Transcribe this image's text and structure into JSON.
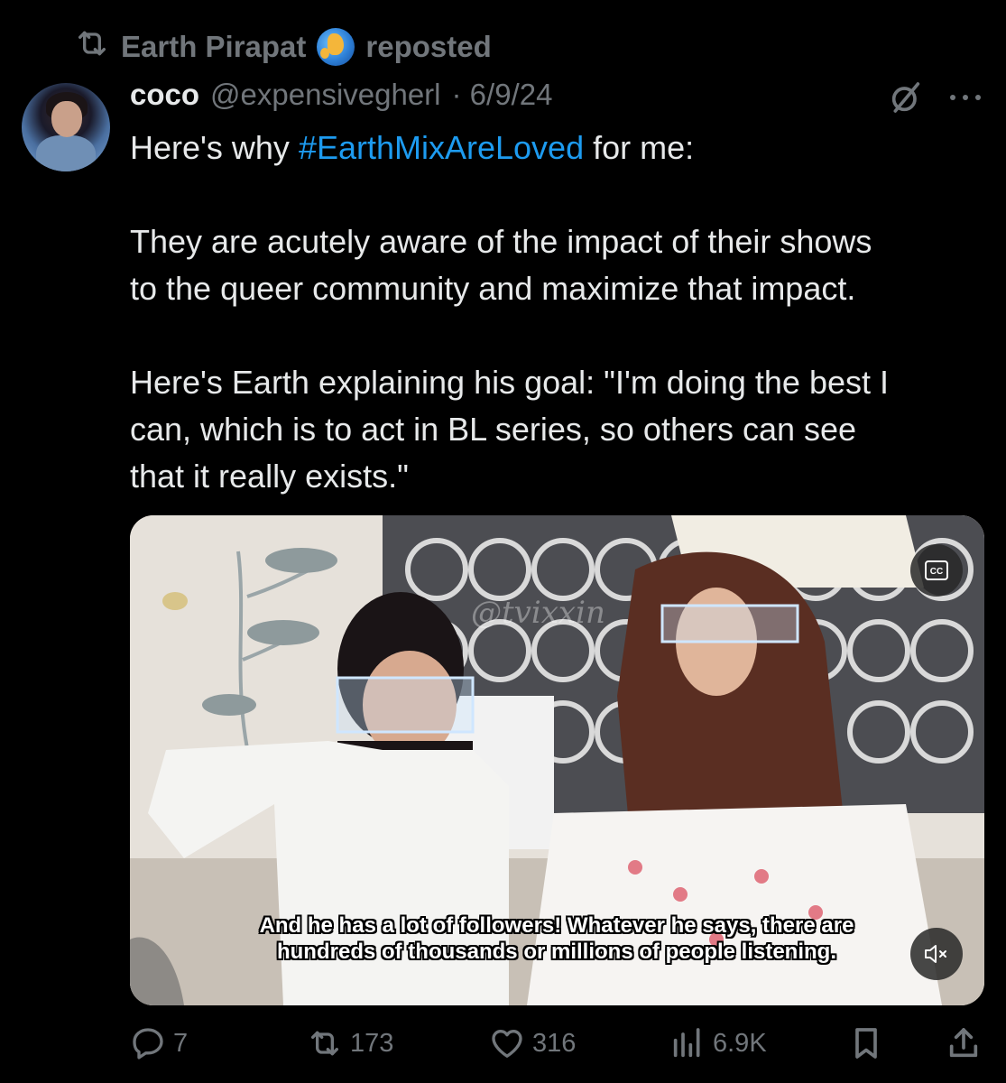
{
  "repost": {
    "user": "Earth Pirapat",
    "emoji_icon": "globe-icon",
    "label": "reposted"
  },
  "tweet": {
    "author_name": "coco",
    "author_handle": "@expensivegherl",
    "date": "· 6/9/24",
    "text_line1_pre": "Here's why ",
    "text_line1_hashtag": "#EarthMixAreLoved",
    "text_line1_post": " for me:",
    "paragraph2": "They are acutely aware of the impact of their shows\nto the queer community and maximize that impact.",
    "paragraph3": "Here's Earth explaining his goal: \"I'm doing the best I\ncan, which is to act in BL series, so others can see\nthat it really exists.\""
  },
  "media": {
    "watermark": "@tvixxin",
    "subtitle_line1": "And he has a lot of followers! Whatever he says, there are",
    "subtitle_line2": "hundreds of thousands or millions of people listening.",
    "cc_label": "CC"
  },
  "actions": {
    "replies": "7",
    "reposts": "173",
    "likes": "316",
    "views": "6.9K"
  },
  "colors": {
    "background": "#000000",
    "text": "#e7e9ea",
    "muted": "#71767b",
    "accent": "#1d9bf0"
  }
}
